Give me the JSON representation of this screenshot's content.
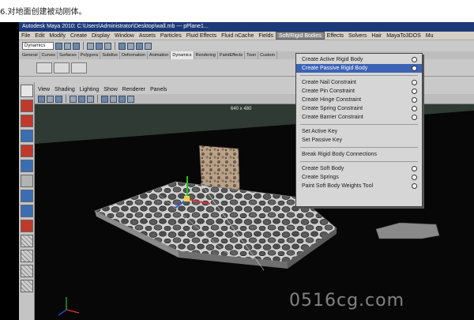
{
  "caption": "6.对地面创建被动刚体。",
  "window": {
    "title": "Autodesk Maya 2010: C:\\Users\\Administrator\\Desktop\\wall.mb  ---  pPlane1..."
  },
  "menubar": {
    "items": [
      "File",
      "Edit",
      "Modify",
      "Create",
      "Display",
      "Window",
      "Assets",
      "Particles",
      "Fluid Effects",
      "Fluid nCache",
      "Fields",
      "Soft/Rigid Bodies",
      "Effects",
      "Solvers",
      "Hair",
      "MayaTo3DOS",
      "Mu"
    ],
    "active_index": 11
  },
  "statusline": {
    "mode": "Dynamics"
  },
  "shelf": {
    "tabs": [
      "General",
      "Curves",
      "Surfaces",
      "Polygons",
      "Subdivs",
      "Deformation",
      "Animation",
      "Dynamics",
      "Rendering",
      "PaintEffects",
      "Toon",
      "Custom"
    ],
    "selected_tab": 7
  },
  "panel_menu": [
    "View",
    "Shading",
    "Lighting",
    "Show",
    "Renderer",
    "Panels"
  ],
  "viewport": {
    "resolution": "640 x 480"
  },
  "dropdown": {
    "highlight_index": 1,
    "groups": [
      [
        "Create Active Rigid Body",
        "Create Passive Rigid Body"
      ],
      [
        "Create Nail Constraint",
        "Create Pin Constraint",
        "Create Hinge Constraint",
        "Create Spring Constraint",
        "Create Barrier Constraint"
      ],
      [
        "Set Active Key",
        "Set Passive Key"
      ],
      [
        "Break Rigid Body Connections"
      ],
      [
        "Create Soft Body",
        "Create Springs",
        "Paint Soft Body Weights Tool"
      ]
    ],
    "items_with_options": [
      "Create Active Rigid Body",
      "Create Passive Rigid Body",
      "Create Nail Constraint",
      "Create Pin Constraint",
      "Create Hinge Constraint",
      "Create Spring Constraint",
      "Create Barrier Constraint",
      "Create Soft Body",
      "Create Springs",
      "Paint Soft Body Weights Tool"
    ]
  },
  "watermark": "0516cg.com",
  "colors": {
    "viewport_bg": "#2e3a33",
    "menu_highlight": "#3c63b4",
    "title_bar": "#1d3a78"
  }
}
